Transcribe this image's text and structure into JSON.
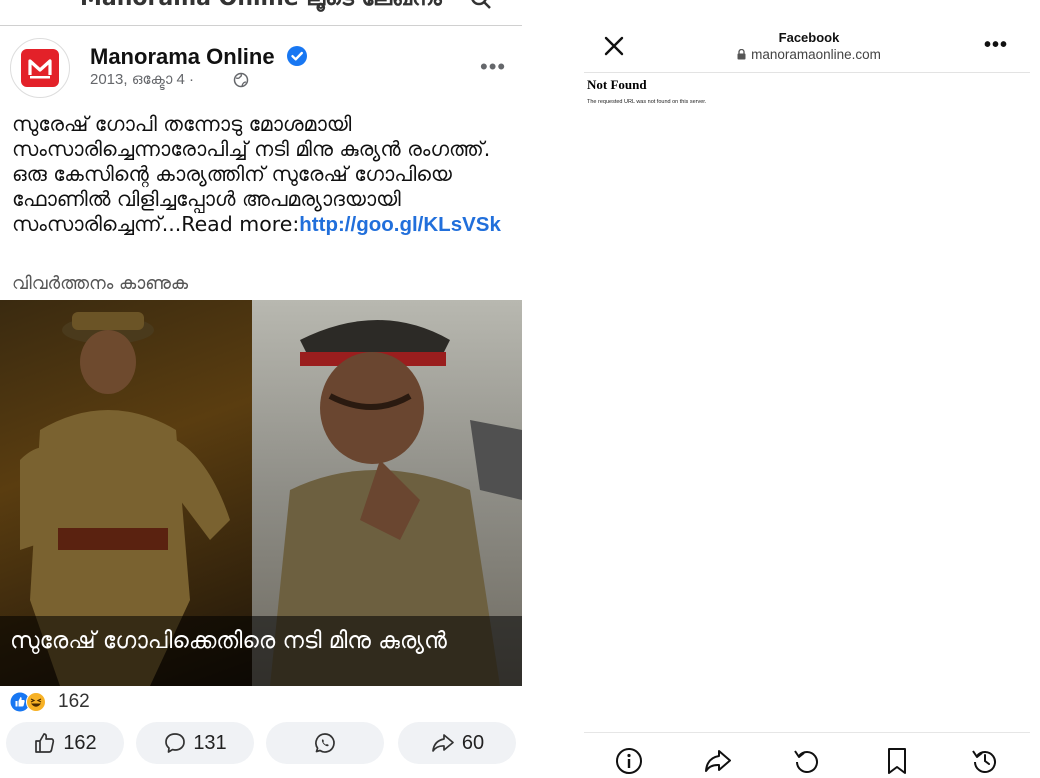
{
  "left": {
    "top_cut_title": "Manorama Online ലൂടെ ലേഖനം",
    "page_name": "Manorama Online",
    "post_date": "2013, ഒക്ടോ 4 ·",
    "post_text": "സുരേഷ് ഗോപി തന്നോടു മോശമായി സംസാരിച്ചെന്നാരോപിച്ച് നടി മിനു കുര്യൻ രംഗത്ത്. ഒരു കേസിന്റെ കാര്യത്തിന് സുരേഷ് ഗോപിയെ ഫോണിൽ വിളിച്ചപ്പോൾ അപമര്യാദയായി സംസാരിച്ചെന്ന്...Read more:",
    "post_link": "http://goo.gl/KLsVSk",
    "translate_label": "വിവർത്തനം കാണുക",
    "image_caption": "സുരേഷ് ഗോപിക്കെതിരെ നടി മിനു കുര്യൻ",
    "reaction_count": "162",
    "actions": {
      "like_count": "162",
      "comment_count": "131",
      "share_count": "60"
    }
  },
  "right": {
    "browser_title": "Facebook",
    "browser_url": "manoramaonline.com",
    "not_found_title": "Not Found",
    "not_found_body": "The requested URL was not found on this server."
  },
  "colors": {
    "link": "#216fdb",
    "verified": "#1877f2",
    "brand_red": "#e32129",
    "button_bg": "#f0f2f5"
  },
  "icons": [
    "search-icon",
    "verified-icon",
    "globe-icon",
    "more-icon",
    "like-icon",
    "haha-icon",
    "comment-icon",
    "whatsapp-icon",
    "share-icon",
    "close-icon",
    "lock-icon",
    "info-icon",
    "forward-icon",
    "refresh-icon",
    "bookmark-icon",
    "history-icon"
  ]
}
